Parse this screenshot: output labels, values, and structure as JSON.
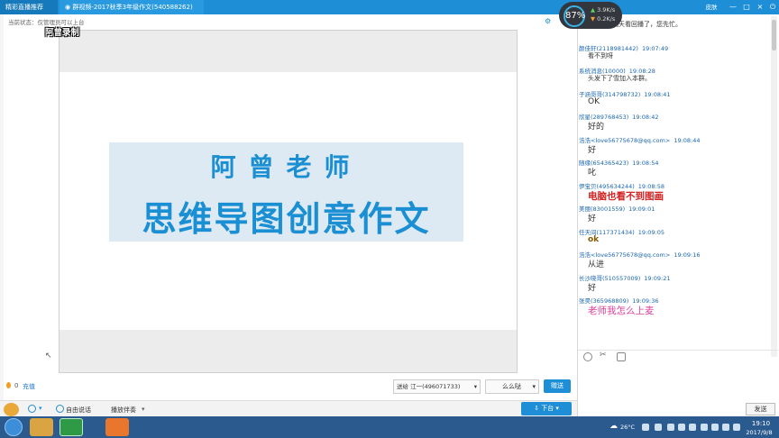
{
  "titlebar": {
    "tab_live": "精彩直播推荐",
    "tab_group": "群视频-2017秋季3年级作文(540588262)",
    "skin": "皮肤",
    "minimize": "—",
    "maximize": "□",
    "close": "×"
  },
  "stage": {
    "status": "当前状态：仅管理员可以上台",
    "watermark": "阿曾录制",
    "slide_teacher": "阿曾老师",
    "slide_title": "思维导图创意作文"
  },
  "bottom": {
    "flower_count": "0",
    "recharge": "充值",
    "mic_select": "江一(496071733)",
    "gift_label": "么么哒",
    "send_gift": "赠送",
    "free_speech": "自由说话",
    "accompany": "播放伴奏",
    "mic_down": "下台"
  },
  "speed_meter": {
    "percent": "87%",
    "up": "3.9K/s",
    "down": "0.2K/s"
  },
  "chat": {
    "messages": [
      {
        "user": "",
        "time": "",
        "body": "老师，我明天看回播了，您先忙。",
        "color": "#333333"
      },
      {
        "user": "颜佳轩(2118981442)",
        "time": "19:07:49",
        "body": "看不到呀",
        "color": "#333333"
      },
      {
        "user": "系统消息(10000)",
        "time": "19:08:28",
        "body": "头发下了雪加入本群。",
        "color": "#333333"
      },
      {
        "user": "子涵哥哥(314798732)",
        "time": "19:08:41",
        "body": "OK",
        "color": "#333333"
      },
      {
        "user": "欣星(289768453)",
        "time": "19:08:42",
        "body": "好的",
        "color": "#333333"
      },
      {
        "user": "浩浩<love56775678@qq.com>",
        "time": "19:08:44",
        "body": "好",
        "color": "#333333"
      },
      {
        "user": "随缘(654365423)",
        "time": "19:08:54",
        "body": "叱",
        "color": "#333333"
      },
      {
        "user": "伊宝贝(495634244)",
        "time": "19:08:58",
        "body": "电脑也看不到图画",
        "color": "#d42020"
      },
      {
        "user": "美丽(83001559)",
        "time": "19:09:01",
        "body": "好",
        "color": "#333333"
      },
      {
        "user": "任天间(117371434)",
        "time": "19:09:05",
        "body": "ok",
        "color": "#8a5a00"
      },
      {
        "user": "浩浩<love56775678@qq.com>",
        "time": "19:09:16",
        "body": "从进",
        "color": "#333333"
      },
      {
        "user": "长沙晓哥(510557009)",
        "time": "19:09:21",
        "body": "好",
        "color": "#333333"
      },
      {
        "user": "张昊(365968809)",
        "time": "19:09:36",
        "body": "老师我怎么上麦",
        "color": "#e0409a"
      }
    ],
    "send": "发送"
  },
  "taskbar": {
    "temperature": "26°C",
    "time": "19:10",
    "date": "2017/9/8"
  }
}
